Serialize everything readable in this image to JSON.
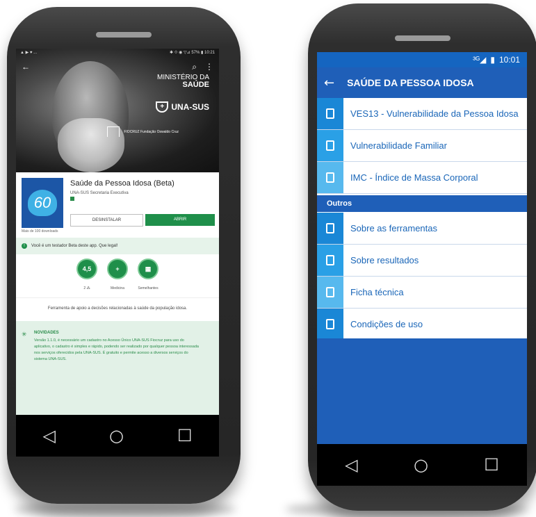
{
  "left_phone": {
    "status_time": "10:21",
    "status_left": "▲ ▶ ♥ ...",
    "status_right": "✱ ⟐ ◉ ▽⊿ 57% ▮ 10:21",
    "back_icon": "←",
    "search_icon": "⌕",
    "menu_icon": "⋮",
    "ministerio_line1": "MINISTÉRIO DA",
    "ministerio_line2": "SAÚDE",
    "unasus_label": "UNA-SUS",
    "fiocruz_label": "FIOCRUZ Fundação Oswaldo Cruz",
    "app_icon_text": "60",
    "app_title": "Saúde da Pessoa Idosa (Beta)",
    "app_developer": "UNA-SUS Secretaria Executiva",
    "downloads": "Mais de 100 downloads",
    "uninstall_label": "DESINSTALAR",
    "open_label": "ABRIR",
    "beta_notice": "Você é um testador Beta deste app. Que legal!",
    "badges": [
      {
        "value": "4,5",
        "label": "2 ⁂"
      },
      {
        "value": "+",
        "label": "Medicina"
      },
      {
        "value": "▦",
        "label": "Semelhantes"
      }
    ],
    "description": "Ferramenta de apoio a decisões relacionadas à saúde da população idosa.",
    "news_title": "NOVIDADES",
    "news_body": "Versão 1.1.0, é necessário um cadastro no Acesso Único UNA-SUS Fiocruz para uso do aplicativo, o cadastro é simples e rápido, podendo ser realizado por qualquer pessoa interessada nos serviços oferecidos pela UNA-SUS. É gratuito e permite acesso a diversos serviços do sistema UNA-SUS.",
    "nav": {
      "back": "◁",
      "home": "○",
      "recents": "☐"
    }
  },
  "right_phone": {
    "status_time": "10:01",
    "status_signal": "³ᴳ◢",
    "status_battery": "▮",
    "toolbar_back": "←",
    "toolbar_title": "SAÚDE DA PESSOA IDOSA",
    "tools": [
      {
        "label": "VES13 - Vulnerabilidade da Pessoa Idosa",
        "icon_color": "#1a87d6"
      },
      {
        "label": "Vulnerabilidade Familiar",
        "icon_color": "#2aa0e6"
      },
      {
        "label": "IMC - Índice de Massa Corporal",
        "icon_color": "#57b9ee"
      }
    ],
    "section_label": "Outros",
    "others": [
      {
        "label": "Sobre as ferramentas",
        "icon_color": "#1a87d6"
      },
      {
        "label": "Sobre resultados",
        "icon_color": "#2aa0e6"
      },
      {
        "label": "Ficha técnica",
        "icon_color": "#57b9ee"
      },
      {
        "label": "Condições de uso",
        "icon_color": "#1a87d6"
      }
    ],
    "nav": {
      "back": "◁",
      "home": "○",
      "recents": "☐"
    }
  }
}
